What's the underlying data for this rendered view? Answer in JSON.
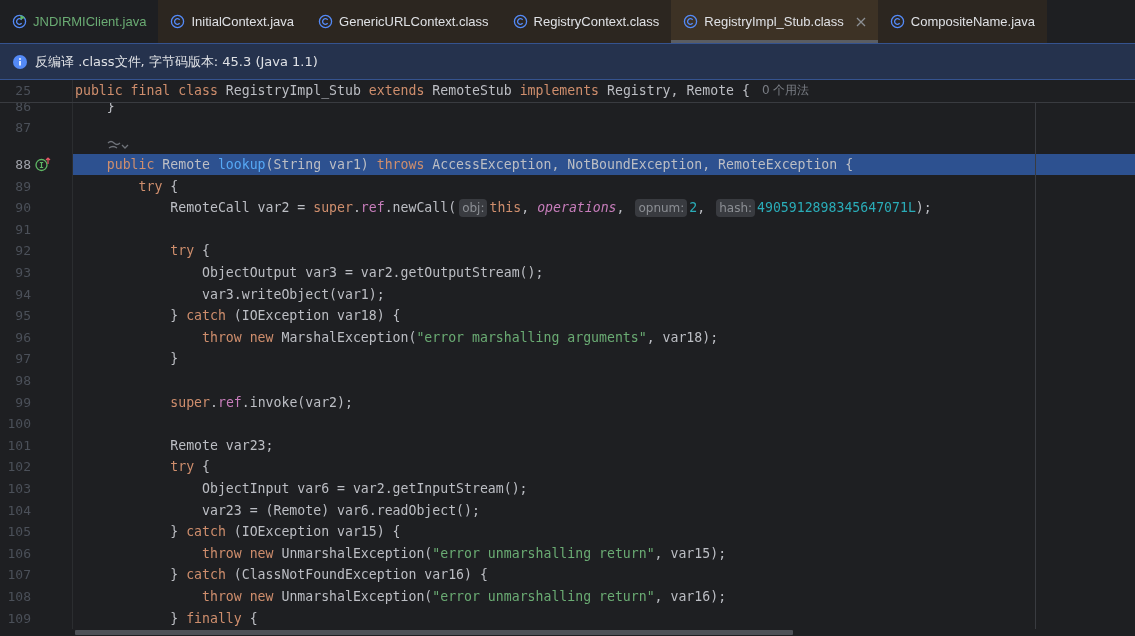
{
  "tabs": [
    {
      "label": "JNDIRMIClient.java",
      "kind": "project",
      "selected": false
    },
    {
      "label": "InitialContext.java",
      "kind": "library",
      "selected": false
    },
    {
      "label": "GenericURLContext.class",
      "kind": "library",
      "selected": false
    },
    {
      "label": "RegistryContext.class",
      "kind": "library",
      "selected": false
    },
    {
      "label": "RegistryImpl_Stub.class",
      "kind": "library",
      "selected": true
    },
    {
      "label": "CompositeName.java",
      "kind": "library",
      "selected": false
    }
  ],
  "info_bar": {
    "text": "反编译 .class文件, 字节码版本: 45.3 (Java 1.1)"
  },
  "sticky_header": {
    "number": "25",
    "tokens": [
      {
        "kind": "kw",
        "text": "public final class "
      },
      {
        "kind": "plain",
        "text": "RegistryImpl_Stub "
      },
      {
        "kind": "kw",
        "text": "extends "
      },
      {
        "kind": "plain",
        "text": "RemoteStub "
      },
      {
        "kind": "kw",
        "text": "implements "
      },
      {
        "kind": "plain",
        "text": "Registry, Remote {"
      }
    ],
    "usages": "0 个用法"
  },
  "lines": [
    {
      "kind": "code",
      "number": "86",
      "selected": false,
      "tokens": [
        {
          "kind": "plain",
          "text": "    }"
        }
      ]
    },
    {
      "kind": "code",
      "number": "87",
      "selected": false
    },
    {
      "kind": "hint-row"
    },
    {
      "kind": "method",
      "number": "88",
      "selected": true,
      "tokens": [
        {
          "kind": "kw",
          "text": "    public "
        },
        {
          "kind": "plain",
          "text": "Remote "
        },
        {
          "kind": "fn",
          "text": "lookup"
        },
        {
          "kind": "plain",
          "text": "(String var1) "
        },
        {
          "kind": "kw",
          "text": "throws "
        },
        {
          "kind": "plain",
          "text": "AccessException, NotBoundException, RemoteException {"
        }
      ]
    },
    {
      "kind": "code",
      "number": "89",
      "selected": false,
      "tokens": [
        {
          "kind": "kw",
          "text": "        try "
        },
        {
          "kind": "plain",
          "text": "{"
        }
      ]
    },
    {
      "kind": "code",
      "number": "90",
      "selected": false,
      "tokens": [
        {
          "kind": "plain",
          "text": "            RemoteCall var2 = "
        },
        {
          "kind": "kw",
          "text": "super"
        },
        {
          "kind": "plain",
          "text": "."
        },
        {
          "kind": "field",
          "text": "ref"
        },
        {
          "kind": "plain",
          "text": ".newCall("
        },
        {
          "kind": "hint",
          "text": "obj:"
        },
        {
          "kind": "kw",
          "text": "this"
        },
        {
          "kind": "plain",
          "text": ", "
        },
        {
          "kind": "static",
          "text": "operations"
        },
        {
          "kind": "plain",
          "text": ", "
        },
        {
          "kind": "hint",
          "text": "opnum:"
        },
        {
          "kind": "num",
          "text": "2"
        },
        {
          "kind": "plain",
          "text": ", "
        },
        {
          "kind": "hint",
          "text": "hash:"
        },
        {
          "kind": "num",
          "text": "4905912898345647071L"
        },
        {
          "kind": "plain",
          "text": ");"
        }
      ]
    },
    {
      "kind": "code",
      "number": "91",
      "selected": false
    },
    {
      "kind": "code",
      "number": "92",
      "selected": false,
      "tokens": [
        {
          "kind": "kw",
          "text": "            try "
        },
        {
          "kind": "plain",
          "text": "{"
        }
      ]
    },
    {
      "kind": "code",
      "number": "93",
      "selected": false,
      "tokens": [
        {
          "kind": "plain",
          "text": "                ObjectOutput var3 = var2.getOutputStream();"
        }
      ]
    },
    {
      "kind": "code",
      "number": "94",
      "selected": false,
      "tokens": [
        {
          "kind": "plain",
          "text": "                var3.writeObject(var1);"
        }
      ]
    },
    {
      "kind": "code",
      "number": "95",
      "selected": false,
      "tokens": [
        {
          "kind": "plain",
          "text": "            } "
        },
        {
          "kind": "kw",
          "text": "catch "
        },
        {
          "kind": "plain",
          "text": "(IOException var18) {"
        }
      ]
    },
    {
      "kind": "code",
      "number": "96",
      "selected": false,
      "tokens": [
        {
          "kind": "kw",
          "text": "                throw new "
        },
        {
          "kind": "plain",
          "text": "MarshalException("
        },
        {
          "kind": "str",
          "text": "\"error marshalling arguments\""
        },
        {
          "kind": "plain",
          "text": ", var18);"
        }
      ]
    },
    {
      "kind": "code",
      "number": "97",
      "selected": false,
      "tokens": [
        {
          "kind": "plain",
          "text": "            }"
        }
      ]
    },
    {
      "kind": "code",
      "number": "98",
      "selected": false
    },
    {
      "kind": "code",
      "number": "99",
      "selected": false,
      "tokens": [
        {
          "kind": "kw",
          "text": "            super"
        },
        {
          "kind": "plain",
          "text": "."
        },
        {
          "kind": "field",
          "text": "ref"
        },
        {
          "kind": "plain",
          "text": ".invoke(var2);"
        }
      ]
    },
    {
      "kind": "code",
      "number": "100",
      "selected": false
    },
    {
      "kind": "code",
      "number": "101",
      "selected": false,
      "tokens": [
        {
          "kind": "plain",
          "text": "            Remote var23;"
        }
      ]
    },
    {
      "kind": "code",
      "number": "102",
      "selected": false,
      "tokens": [
        {
          "kind": "kw",
          "text": "            try "
        },
        {
          "kind": "plain",
          "text": "{"
        }
      ]
    },
    {
      "kind": "code",
      "number": "103",
      "selected": false,
      "tokens": [
        {
          "kind": "plain",
          "text": "                ObjectInput var6 = var2.getInputStream();"
        }
      ]
    },
    {
      "kind": "code",
      "number": "104",
      "selected": false,
      "tokens": [
        {
          "kind": "plain",
          "text": "                var23 = (Remote) var6.readObject();"
        }
      ]
    },
    {
      "kind": "code",
      "number": "105",
      "selected": false,
      "tokens": [
        {
          "kind": "plain",
          "text": "            } "
        },
        {
          "kind": "kw",
          "text": "catch "
        },
        {
          "kind": "plain",
          "text": "(IOException var15) {"
        }
      ]
    },
    {
      "kind": "code",
      "number": "106",
      "selected": false,
      "tokens": [
        {
          "kind": "kw",
          "text": "                throw new "
        },
        {
          "kind": "plain",
          "text": "UnmarshalException("
        },
        {
          "kind": "str",
          "text": "\"error unmarshalling return\""
        },
        {
          "kind": "plain",
          "text": ", var15);"
        }
      ]
    },
    {
      "kind": "code",
      "number": "107",
      "selected": false,
      "tokens": [
        {
          "kind": "plain",
          "text": "            } "
        },
        {
          "kind": "kw",
          "text": "catch "
        },
        {
          "kind": "plain",
          "text": "(ClassNotFoundException var16) {"
        }
      ]
    },
    {
      "kind": "code",
      "number": "108",
      "selected": false,
      "tokens": [
        {
          "kind": "kw",
          "text": "                throw new "
        },
        {
          "kind": "plain",
          "text": "UnmarshalException("
        },
        {
          "kind": "str",
          "text": "\"error unmarshalling return\""
        },
        {
          "kind": "plain",
          "text": ", var16);"
        }
      ]
    },
    {
      "kind": "code",
      "number": "109",
      "selected": false,
      "tokens": [
        {
          "kind": "plain",
          "text": "            } "
        },
        {
          "kind": "kw",
          "text": "finally "
        },
        {
          "kind": "plain",
          "text": "{"
        }
      ]
    }
  ]
}
